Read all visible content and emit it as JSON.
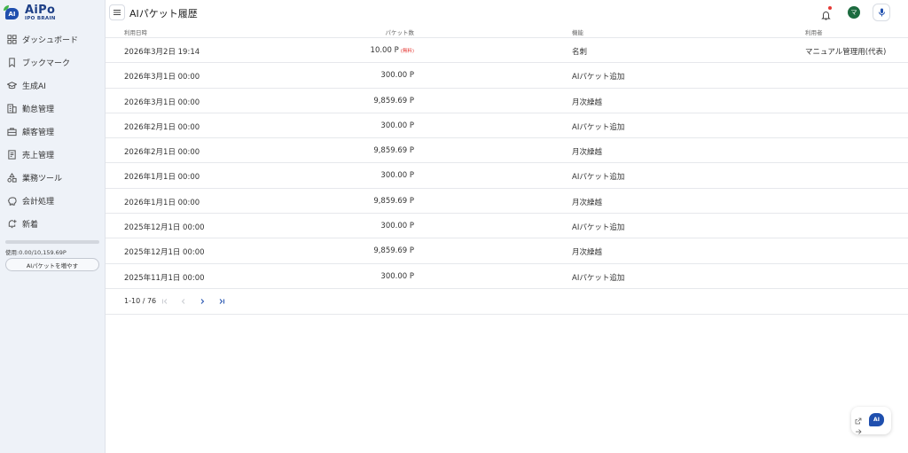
{
  "logo": {
    "brand": "AiPo",
    "sub": "IPO BRAIN",
    "mark_text": "AI"
  },
  "sidebar": {
    "items": [
      {
        "label": "ダッシュボード",
        "icon": "dashboard-icon"
      },
      {
        "label": "ブックマーク",
        "icon": "bookmark-icon"
      },
      {
        "label": "生成AI",
        "icon": "graduation-cap-icon"
      },
      {
        "label": "勤怠管理",
        "icon": "building-icon"
      },
      {
        "label": "顧客管理",
        "icon": "briefcase-icon"
      },
      {
        "label": "売上管理",
        "icon": "receipt-icon"
      },
      {
        "label": "業務ツール",
        "icon": "shapes-icon"
      },
      {
        "label": "会計処理",
        "icon": "piggy-bank-icon"
      },
      {
        "label": "新着",
        "icon": "notification-add-icon"
      }
    ],
    "usage_text": "使用:0.00/10,159.69P",
    "usage_fraction": 0.0,
    "add_button": "AIパケットを増やす"
  },
  "header": {
    "title": "AIパケット履歴",
    "avatar_initial": "マ"
  },
  "table": {
    "headers": {
      "date": "利用日時",
      "amount": "パケット数",
      "function": "機能",
      "user": "利用者"
    },
    "rows": [
      {
        "date": "2026年3月2日 19:14",
        "amount": "10.00 P",
        "free": "(無料)",
        "function": "名刺",
        "user": "マニュアル管理用(代表)"
      },
      {
        "date": "2026年3月1日 00:00",
        "amount": "300.00 P",
        "free": "",
        "function": "AIパケット追加",
        "user": ""
      },
      {
        "date": "2026年3月1日 00:00",
        "amount": "9,859.69 P",
        "free": "",
        "function": "月次繰越",
        "user": ""
      },
      {
        "date": "2026年2月1日 00:00",
        "amount": "300.00 P",
        "free": "",
        "function": "AIパケット追加",
        "user": ""
      },
      {
        "date": "2026年2月1日 00:00",
        "amount": "9,859.69 P",
        "free": "",
        "function": "月次繰越",
        "user": ""
      },
      {
        "date": "2026年1月1日 00:00",
        "amount": "300.00 P",
        "free": "",
        "function": "AIパケット追加",
        "user": ""
      },
      {
        "date": "2026年1月1日 00:00",
        "amount": "9,859.69 P",
        "free": "",
        "function": "月次繰越",
        "user": ""
      },
      {
        "date": "2025年12月1日 00:00",
        "amount": "300.00 P",
        "free": "",
        "function": "AIパケット追加",
        "user": ""
      },
      {
        "date": "2025年12月1日 00:00",
        "amount": "9,859.69 P",
        "free": "",
        "function": "月次繰越",
        "user": ""
      },
      {
        "date": "2025年11月1日 00:00",
        "amount": "300.00 P",
        "free": "",
        "function": "AIパケット追加",
        "user": ""
      }
    ]
  },
  "pagination": {
    "range_text": "1-10 / 76"
  },
  "assistant": {
    "label": "AI"
  },
  "colors": {
    "brand": "#1f4fae",
    "sidebar_bg": "#eef2f8",
    "free_tag": "#e53935",
    "avatar": "#1c6b3f",
    "pager_active": "#1f4fae"
  }
}
